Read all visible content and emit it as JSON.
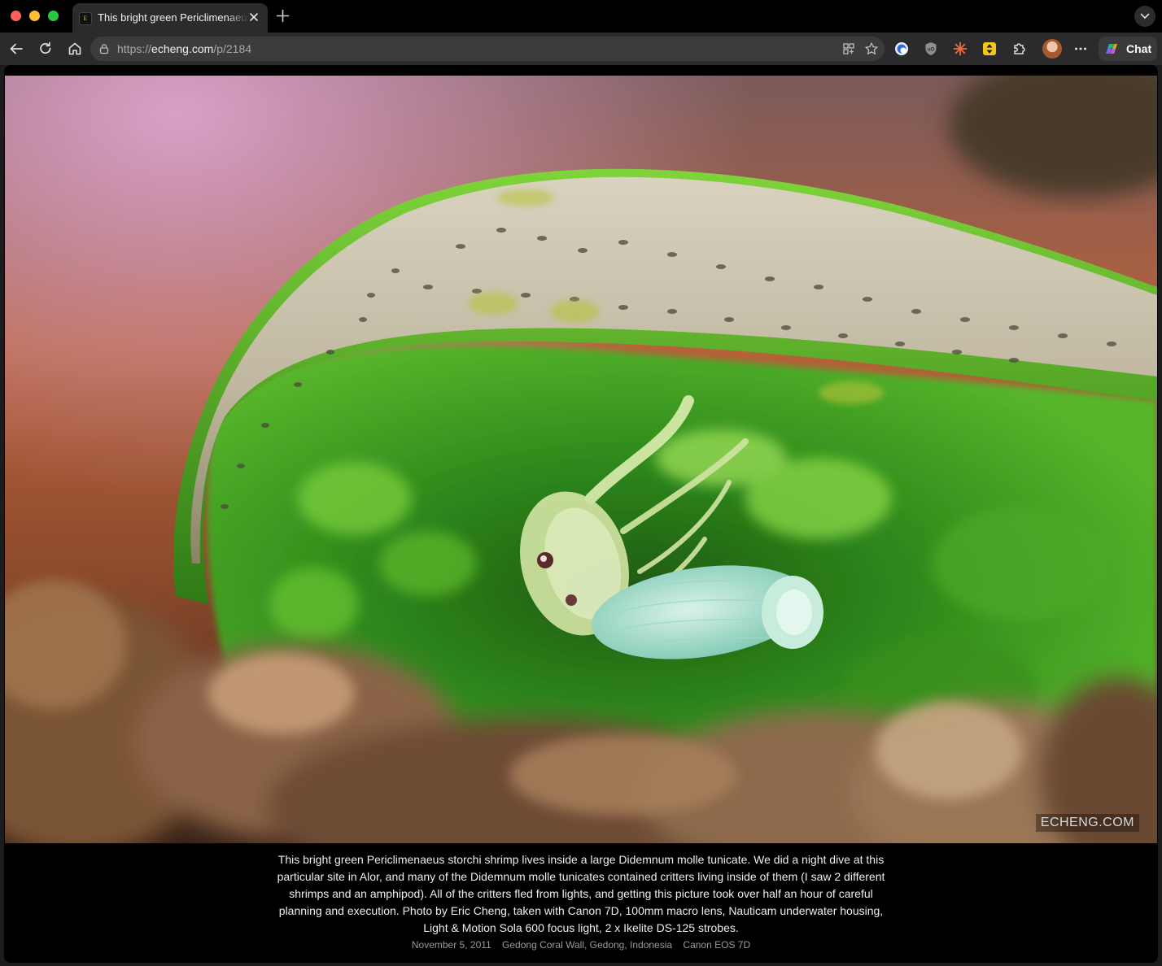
{
  "browser": {
    "tab": {
      "title": "This bright green Periclimenaeus",
      "favicon": "E"
    },
    "address": {
      "scheme": "https://",
      "domain": "echeng.com",
      "path": "/p/2184"
    },
    "chat_label": "Chat"
  },
  "photo": {
    "watermark": "ECHENG.COM",
    "caption": "This bright green Periclimenaeus storchi shrimp lives inside a large Didemnum molle tunicate. We did a night dive at this particular site in Alor, and many of the Didemnum molle tunicates contained critters living inside of them (I saw 2 different shrimps and an amphipod). All of the critters fled from lights, and getting this picture took over half an hour of careful planning and execution. Photo by Eric Cheng, taken with Canon 7D, 100mm macro lens, Nauticam underwater housing, Light & Motion Sola 600 focus light, 2 x Ikelite DS-125 strobes.",
    "meta": {
      "date": "November 5, 2011",
      "location": "Gedong Coral Wall, Gedong, Indonesia",
      "camera": "Canon EOS 7D"
    }
  },
  "colors": {
    "tab_bg": "#2b2b2d",
    "toolbar_bg": "#2b2b2d",
    "page_bg": "#000000"
  }
}
